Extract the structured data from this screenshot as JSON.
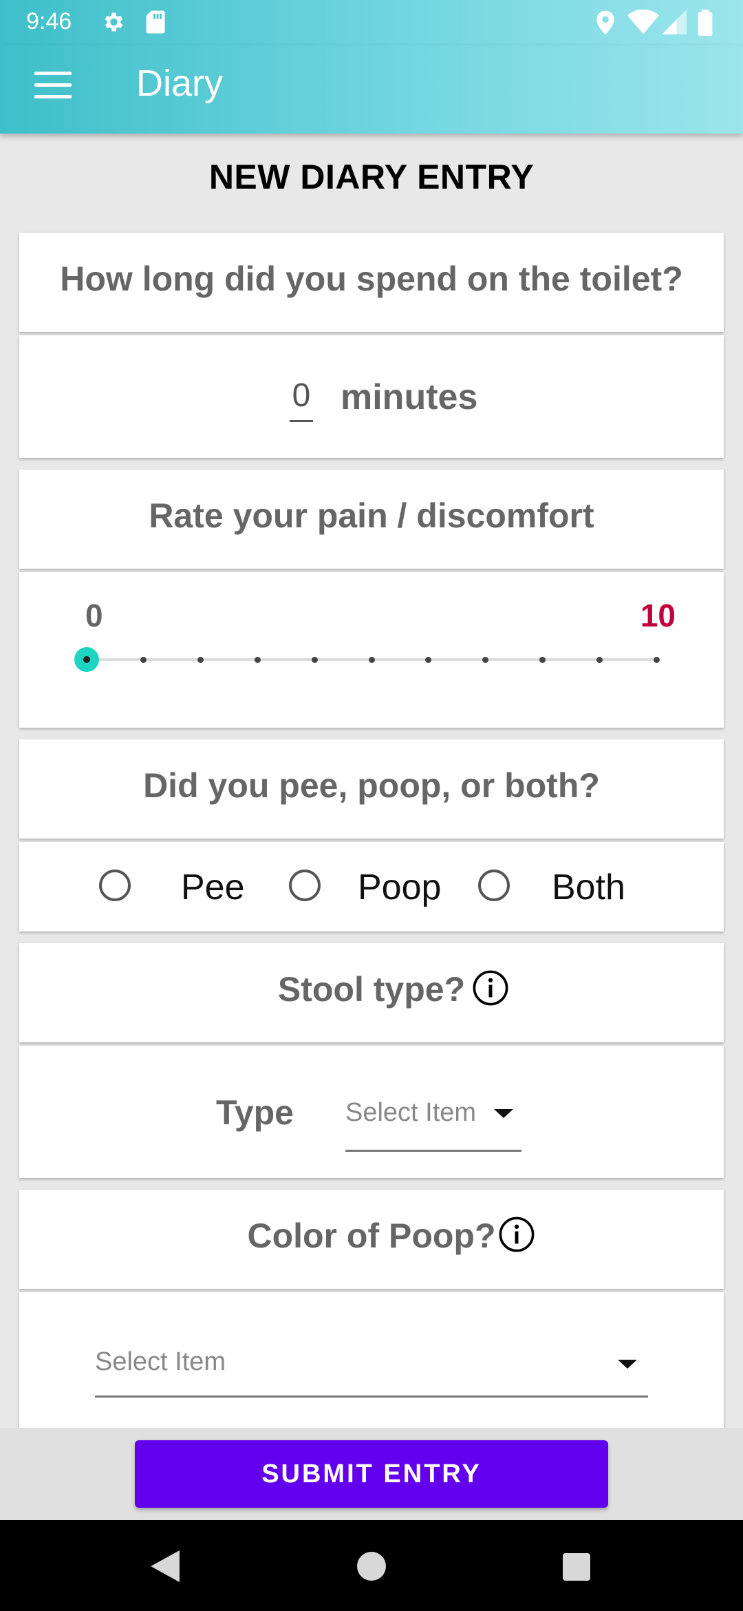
{
  "status_bar": {
    "time": "9:46",
    "icons": [
      "settings-icon",
      "sd-card-icon",
      "location-icon",
      "wifi-icon",
      "signal-icon",
      "battery-icon"
    ]
  },
  "app_bar": {
    "menu_icon": "hamburger-menu-icon",
    "title": "Diary"
  },
  "page": {
    "heading": "NEW DIARY ENTRY"
  },
  "duration": {
    "question": "How long did you spend on the toilet?",
    "value": "0",
    "unit": "minutes"
  },
  "pain": {
    "question": "Rate your pain / discomfort",
    "min_label": "0",
    "max_label": "10",
    "value": 0,
    "min": 0,
    "max": 10,
    "thumb_color": "#1dd3c1",
    "max_color": "#c2003b"
  },
  "type_choice": {
    "question": "Did you pee, poop, or both?",
    "options": [
      "Pee",
      "Poop",
      "Both"
    ],
    "selected": null
  },
  "stool_type": {
    "question": "Stool type?",
    "field_label": "Type",
    "placeholder": "Select Item"
  },
  "poop_color": {
    "question": "Color of Poop?",
    "placeholder": "Select Item"
  },
  "submit": {
    "label": "SUBMIT ENTRY",
    "color": "#6200ee"
  },
  "nav_bar": {
    "icons": [
      "back-icon",
      "home-icon",
      "recents-icon"
    ]
  }
}
